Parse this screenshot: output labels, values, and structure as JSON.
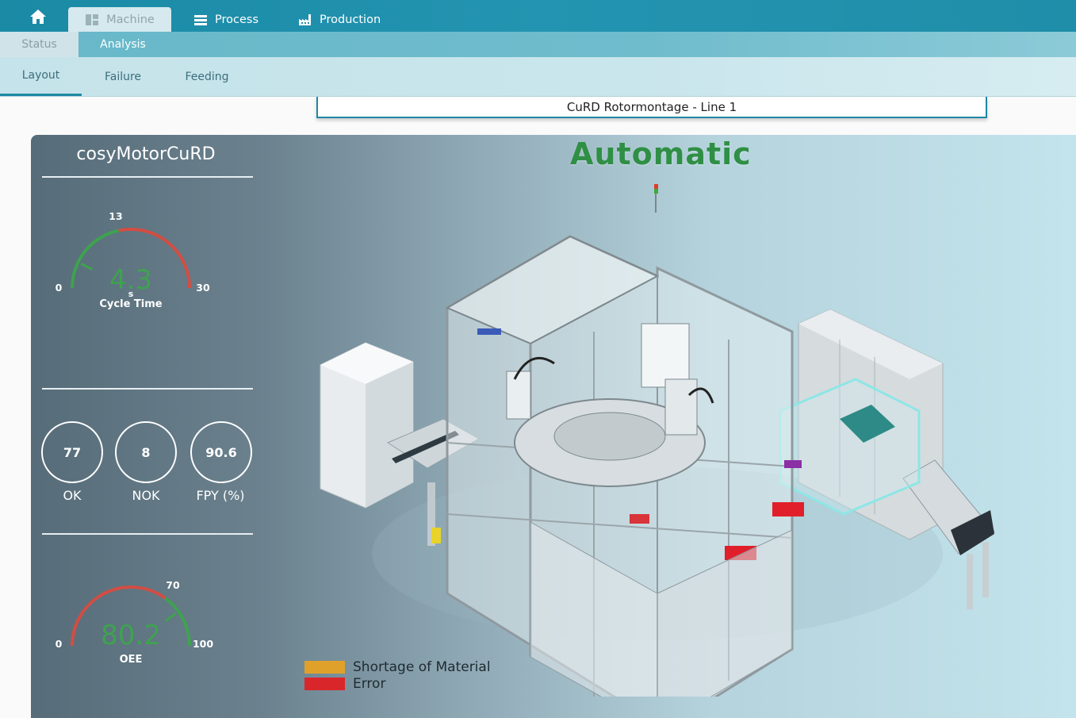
{
  "nav": {
    "tabs": [
      {
        "label": "Machine",
        "icon": "grid-icon",
        "active": true
      },
      {
        "label": "Process",
        "icon": "list-icon"
      },
      {
        "label": "Production",
        "icon": "factory-icon"
      }
    ]
  },
  "subnav": {
    "level1": [
      {
        "label": "Status"
      },
      {
        "label": "Analysis",
        "active": true
      }
    ],
    "level2": [
      {
        "label": "Layout",
        "active": true
      },
      {
        "label": "Failure"
      },
      {
        "label": "Feeding"
      }
    ]
  },
  "line_title": "CuRD Rotormontage - Line 1",
  "machine": {
    "name": "cosyMotorCuRD",
    "mode": "Automatic",
    "cycle_time": {
      "value": "4.3",
      "unit": "s",
      "label": "Cycle Time",
      "min": "0",
      "max": "30",
      "target": "13",
      "value_num": 4.3,
      "min_num": 0,
      "max_num": 30,
      "target_num": 13
    },
    "counters": [
      {
        "value": "77",
        "label": "OK"
      },
      {
        "value": "8",
        "label": "NOK"
      },
      {
        "value": "90.6",
        "label": "FPY (%)"
      }
    ],
    "oee": {
      "value": "80.2",
      "label": "OEE",
      "min": "0",
      "max": "100",
      "target": "70",
      "value_num": 80.2,
      "min_num": 0,
      "max_num": 100,
      "target_num": 70
    }
  },
  "legend": [
    {
      "label": "Shortage of Material",
      "color": "#e0a12a"
    },
    {
      "label": "Error",
      "color": "#d9262a"
    }
  ],
  "colors": {
    "accent": "#1e88a5",
    "good": "#3ea24f",
    "bad": "#d24d43"
  }
}
